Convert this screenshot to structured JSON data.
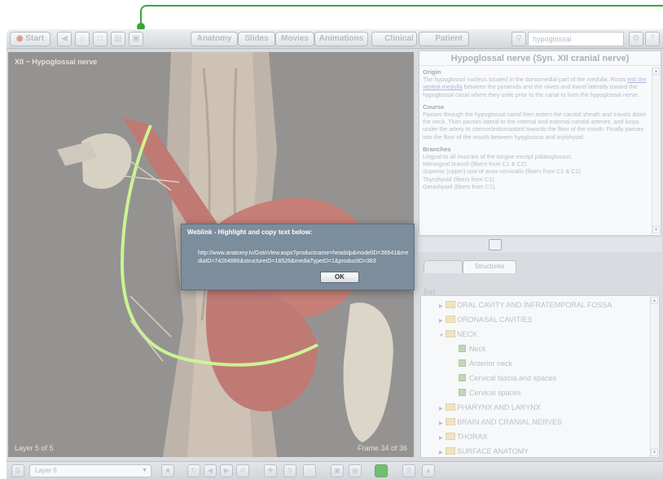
{
  "toolbar": {
    "start_label": "Start",
    "tabs": [
      "Anatomy",
      "Slides",
      "Movies",
      "Animations",
      "Clinical",
      "Patient"
    ],
    "search_value": "hypoglossal"
  },
  "viewer": {
    "title": "XII ~ Hypoglossal nerve",
    "layer_status": "Layer 5 of 5",
    "frame_status": "Frame 34 of 36"
  },
  "info": {
    "title": "Hypoglossal nerve (Syn. XII cranial nerve)",
    "sections": [
      {
        "heading": "Origin",
        "text_before": "The hypoglossal nucleus located in the dorsomedial part of the medulla. Roots ",
        "link": "exit the ventral medulla",
        "text_after": " between the pyramids and the olives and travel laterally toward the hypoglossal canal where they unite prior to the canal to form the hypoglossal nerve."
      },
      {
        "heading": "Course",
        "text": "Passes through the hypoglossal canal then enters the carotid sheath and travels down the neck. Then passes lateral to the internal and external carotid arteries, and loops under the artery to sternocleidomastoid towards the floor of the mouth. Finally passes into the floor of the mouth between hyoglossus and mylohyoid."
      },
      {
        "heading": "Branches",
        "lines": [
          "Lingual to all muscles of the tongue except palatoglossus.",
          "Meningeal branch (fibers from C1 & C2).",
          "Superior (upper) root of ansa cervicalis (fibers from C1 & C2).",
          "Thyrohyoid (fibers from C1).",
          "Geniohyoid (fibers from C1)."
        ]
      }
    ]
  },
  "panel_tabs": [
    "Structures"
  ],
  "list_heading": "list",
  "tree": {
    "items": [
      {
        "label": "ORAL CAVITY AND INFRATEMPORAL FOSSA",
        "type": "folder",
        "expanded": false
      },
      {
        "label": "ORONASAL CAVITIES",
        "type": "folder",
        "expanded": false
      },
      {
        "label": "NECK",
        "type": "folder",
        "expanded": true
      },
      {
        "label": "Neck",
        "type": "leaf"
      },
      {
        "label": "Anterior neck",
        "type": "leaf"
      },
      {
        "label": "Cervical fascia and spaces",
        "type": "leaf"
      },
      {
        "label": "Cervical spaces",
        "type": "leaf"
      },
      {
        "label": "PHARYNX AND LARYNX",
        "type": "folder",
        "expanded": false
      },
      {
        "label": "BRAIN AND CRANIAL NERVES",
        "type": "folder",
        "expanded": false
      },
      {
        "label": "THORAX",
        "type": "folder",
        "expanded": false
      },
      {
        "label": "SURFACE ANATOMY",
        "type": "folder",
        "expanded": false
      }
    ]
  },
  "bottom": {
    "layer_value": "Layer 5"
  },
  "dialog": {
    "title": "Weblink - Highlight and copy text below:",
    "url": "http://www.anatomy.tv/GotoView.aspx?productname=headslp&modelID=36641&mediaID=74264886&structureID=18526&mediaTypeID=1&productID=383",
    "ok_label": "OK"
  },
  "colors": {
    "connector": "#3aa637",
    "dialog_bg": "#7c8d9d",
    "nerve": "#b7f06a",
    "muscle": "#cf5a50"
  }
}
